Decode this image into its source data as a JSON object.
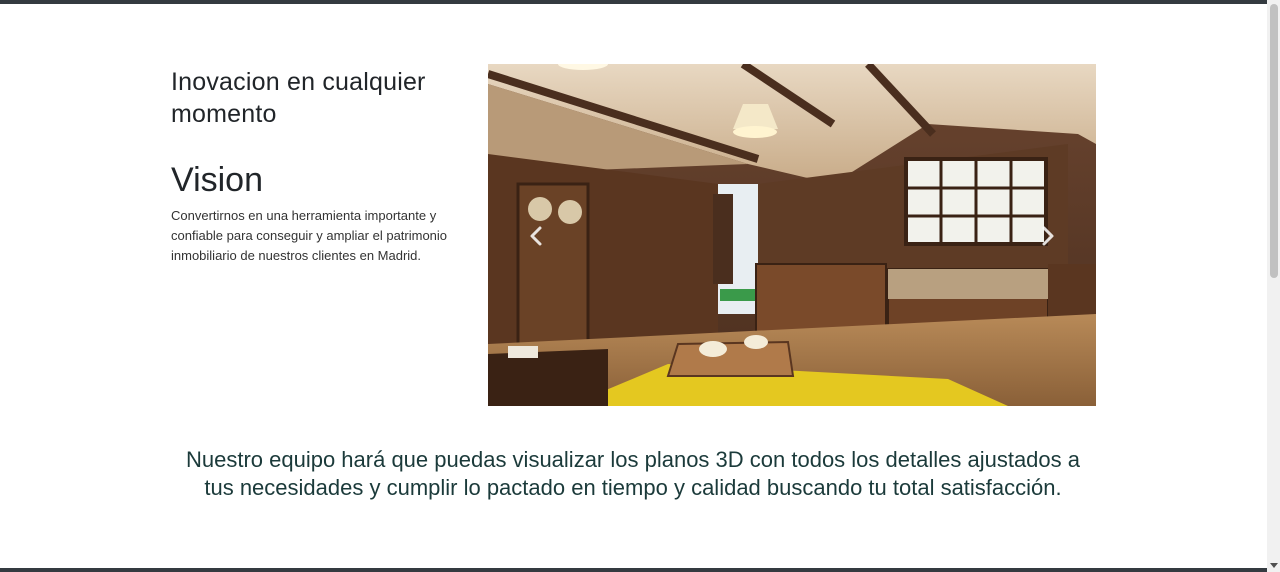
{
  "section": {
    "title": "Inovacion en cualquier momento",
    "subtitle": "Vision",
    "description": "Convertirnos en una herramienta importante y confiable para conseguir y ampliar el patrimonio inmobiliario de nuestros clientes en Madrid."
  },
  "carousel": {
    "prev_icon": "chevron-left-icon",
    "next_icon": "chevron-right-icon"
  },
  "tagline": "Nuestro equipo hará que puedas visualizar los planos 3D con todos los detalles ajustados a tus necesidades y cumplir lo pactado en tiempo y calidad buscando tu total satisfacción.",
  "colors": {
    "top_bar": "#343a40",
    "tagline_text": "#1b3a3a",
    "heading_text": "#212529"
  }
}
